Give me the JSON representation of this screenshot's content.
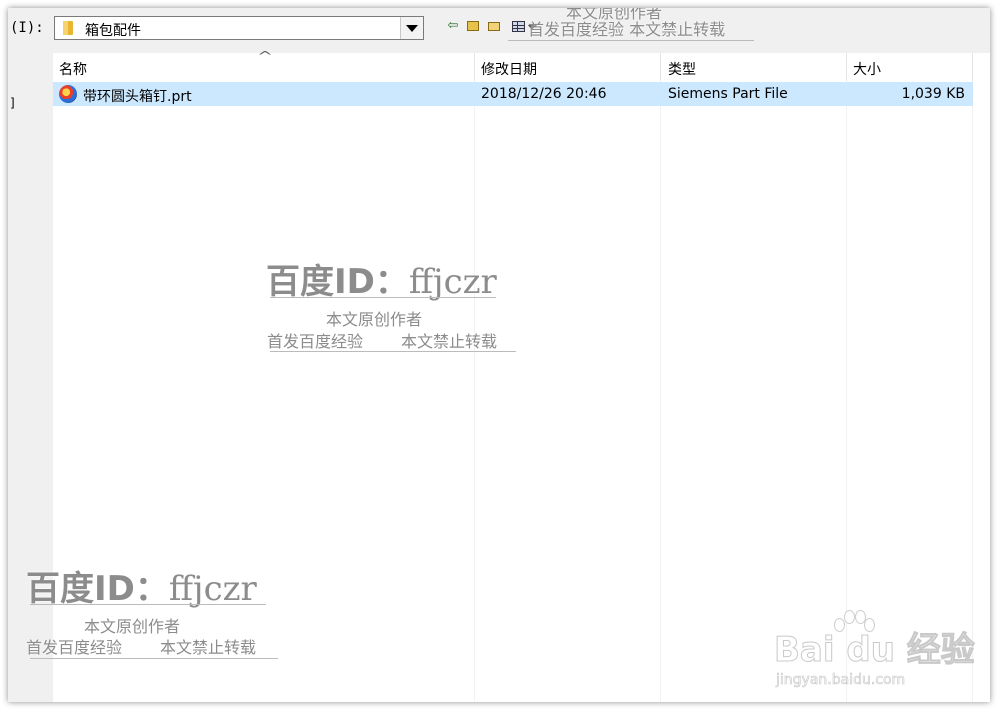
{
  "toolbar": {
    "look_in_label": "(I):",
    "location": "箱包配件"
  },
  "left_pane": {
    "bracket": "]"
  },
  "file_list": {
    "sort_indicator": "^",
    "columns": [
      "名称",
      "修改日期",
      "类型",
      "大小"
    ],
    "rows": [
      {
        "name": "带环圆头箱钉.prt",
        "modified": "2018/12/26 20:46",
        "type": "Siemens Part File",
        "size": "1,039 KB",
        "icon": "siemens-nx-part-icon"
      }
    ]
  },
  "watermark": {
    "id_label": "百度ID：",
    "id_value": "ffjczr",
    "line1": "本文原创作者",
    "line2_a": "首发百度经验",
    "line2_b": "本文禁止转载",
    "top_line1": "本文原创作者",
    "top_line2": "首发百度经验    本文禁止转载",
    "brand": "Bai du 经验",
    "brand_url": "jingyan.baidu.com"
  },
  "colors": {
    "selection": "#cce8ff",
    "window_bg": "#f0f0f0",
    "list_bg": "#ffffff"
  }
}
